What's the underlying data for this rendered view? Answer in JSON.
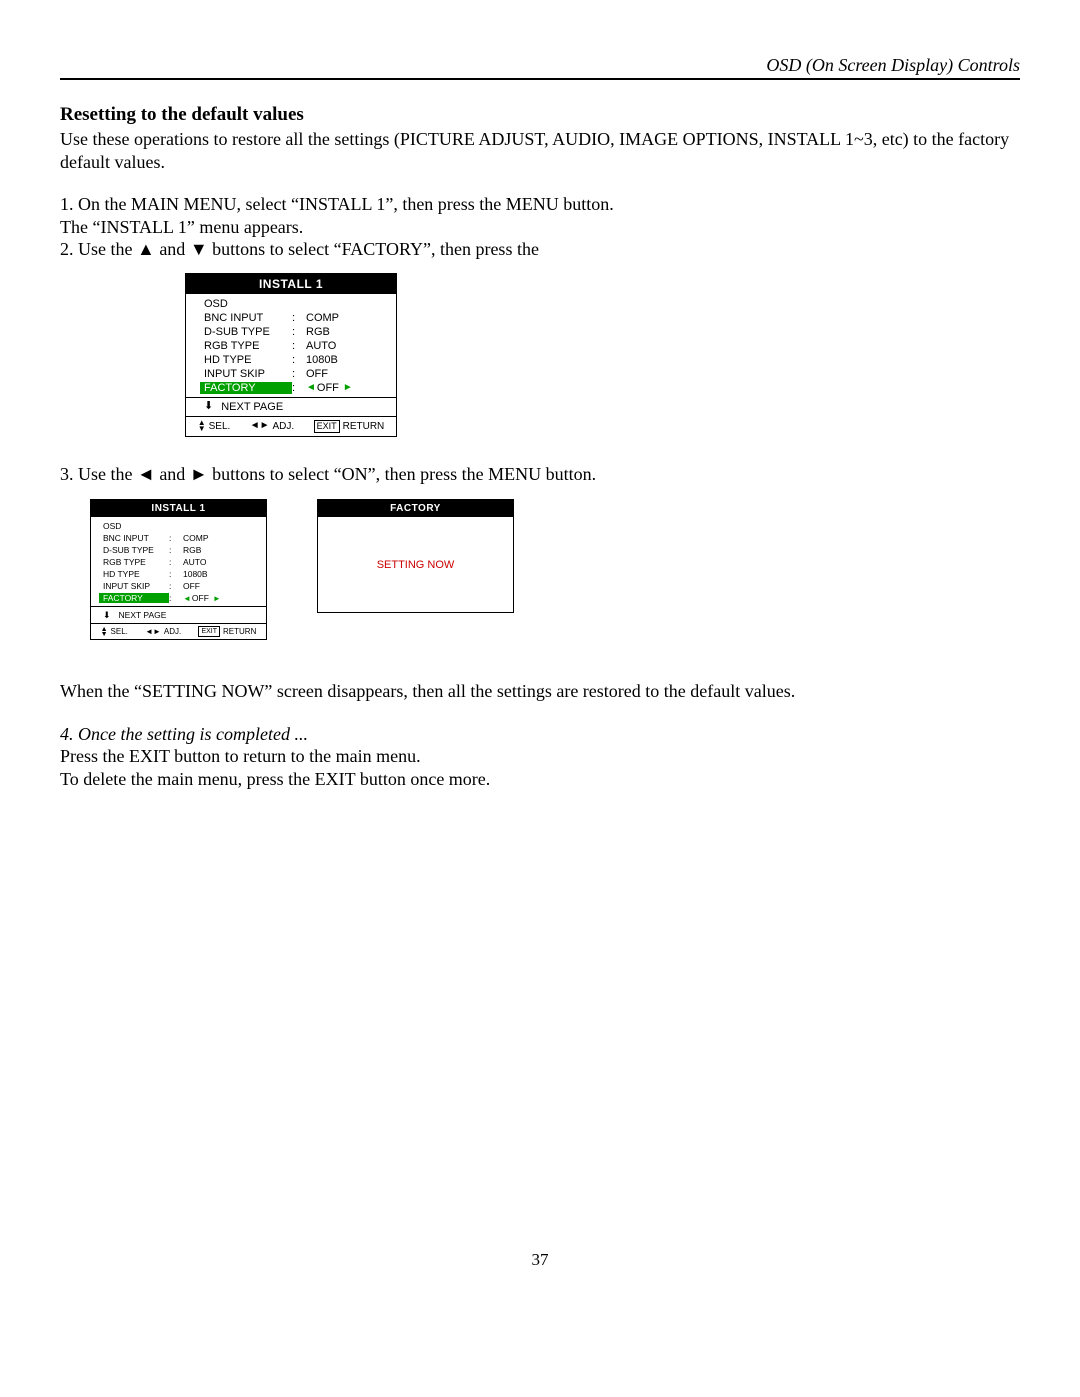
{
  "header": "OSD (On Screen Display) Controls",
  "section_heading": "Resetting to the default values",
  "intro": "Use these operations to restore all the settings (PICTURE ADJUST, AUDIO, IMAGE OPTIONS, INSTALL 1~3, etc) to the factory default values.",
  "step1a": "1. On the MAIN MENU, select “INSTALL 1”, then press the MENU button.",
  "step1b": "The “INSTALL 1” menu appears.",
  "step2_pre": "2. Use the ",
  "step2_post": " buttons to select “FACTORY”, then press the",
  "step2_and": " and ",
  "up_tri": "▲",
  "down_tri": "▼",
  "step3_pre": "3. Use the ",
  "step3_post": " buttons to select “ON”, then press the MENU button.",
  "step3_and": " and ",
  "left_tri": "◄",
  "right_tri": "►",
  "when_text": "When the “SETTING NOW” screen disappears, then all the settings are restored to the default values.",
  "step4_italic": "4. Once the setting is completed ...",
  "step4_a": "Press the EXIT button to return to the main menu.",
  "step4_b": "To delete the main menu, press the EXIT button once more.",
  "page_number": "37",
  "menu": {
    "title": "INSTALL 1",
    "items": [
      {
        "label": "OSD",
        "value": ""
      },
      {
        "label": "BNC INPUT",
        "value": "COMP"
      },
      {
        "label": "D-SUB TYPE",
        "value": "RGB"
      },
      {
        "label": "RGB TYPE",
        "value": "AUTO"
      },
      {
        "label": "HD TYPE",
        "value": "1080B"
      },
      {
        "label": "INPUT SKIP",
        "value": "OFF"
      }
    ],
    "factory_label": "FACTORY",
    "factory_value": "OFF",
    "next_page": "NEXT PAGE",
    "footer": {
      "sel": "SEL.",
      "adj": "ADJ.",
      "exit": "EXIT",
      "ret": "RETURN"
    }
  },
  "factory_menu": {
    "title": "FACTORY",
    "text": "SETTING NOW"
  }
}
